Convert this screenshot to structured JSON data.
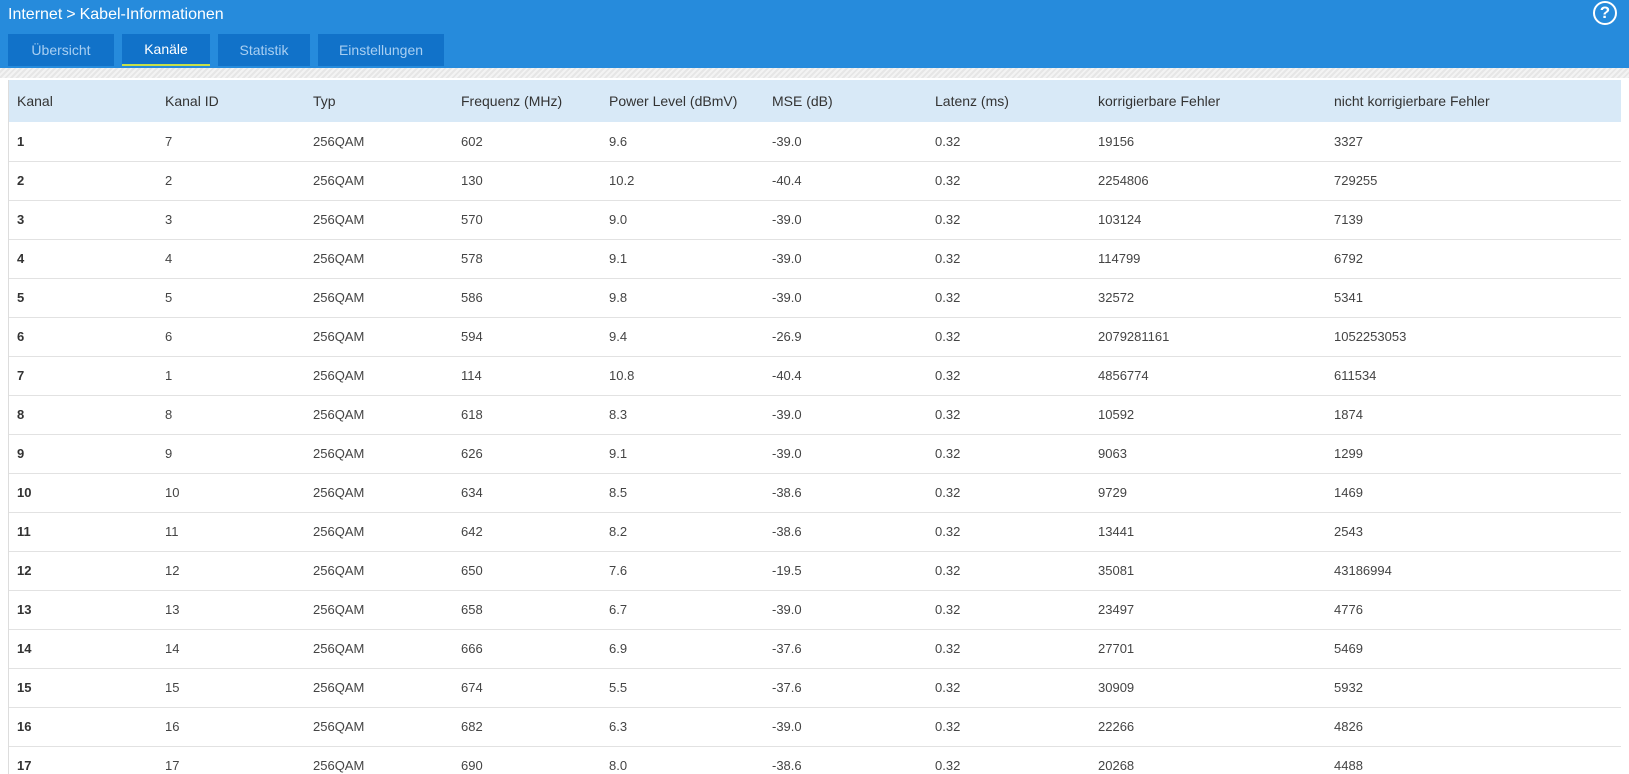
{
  "breadcrumb": {
    "parent": "Internet",
    "separator": ">",
    "current": "Kabel-Informationen"
  },
  "help_label": "?",
  "tabs": [
    {
      "label": "Übersicht",
      "active": false
    },
    {
      "label": "Kanäle",
      "active": true
    },
    {
      "label": "Statistik",
      "active": false
    },
    {
      "label": "Einstellungen",
      "active": false
    }
  ],
  "colors": {
    "header": "#268bdc",
    "tab": "#1172c9",
    "active_underline": "#c6e04a",
    "table_header": "#d8e9f7"
  },
  "table": {
    "columns": [
      "Kanal",
      "Kanal ID",
      "Typ",
      "Frequenz (MHz)",
      "Power Level (dBmV)",
      "MSE (dB)",
      "Latenz (ms)",
      "korrigierbare Fehler",
      "nicht korrigierbare Fehler"
    ],
    "rows": [
      [
        "1",
        "7",
        "256QAM",
        "602",
        "9.6",
        "-39.0",
        "0.32",
        "19156",
        "3327"
      ],
      [
        "2",
        "2",
        "256QAM",
        "130",
        "10.2",
        "-40.4",
        "0.32",
        "2254806",
        "729255"
      ],
      [
        "3",
        "3",
        "256QAM",
        "570",
        "9.0",
        "-39.0",
        "0.32",
        "103124",
        "7139"
      ],
      [
        "4",
        "4",
        "256QAM",
        "578",
        "9.1",
        "-39.0",
        "0.32",
        "114799",
        "6792"
      ],
      [
        "5",
        "5",
        "256QAM",
        "586",
        "9.8",
        "-39.0",
        "0.32",
        "32572",
        "5341"
      ],
      [
        "6",
        "6",
        "256QAM",
        "594",
        "9.4",
        "-26.9",
        "0.32",
        "2079281161",
        "1052253053"
      ],
      [
        "7",
        "1",
        "256QAM",
        "114",
        "10.8",
        "-40.4",
        "0.32",
        "4856774",
        "611534"
      ],
      [
        "8",
        "8",
        "256QAM",
        "618",
        "8.3",
        "-39.0",
        "0.32",
        "10592",
        "1874"
      ],
      [
        "9",
        "9",
        "256QAM",
        "626",
        "9.1",
        "-39.0",
        "0.32",
        "9063",
        "1299"
      ],
      [
        "10",
        "10",
        "256QAM",
        "634",
        "8.5",
        "-38.6",
        "0.32",
        "9729",
        "1469"
      ],
      [
        "11",
        "11",
        "256QAM",
        "642",
        "8.2",
        "-38.6",
        "0.32",
        "13441",
        "2543"
      ],
      [
        "12",
        "12",
        "256QAM",
        "650",
        "7.6",
        "-19.5",
        "0.32",
        "35081",
        "43186994"
      ],
      [
        "13",
        "13",
        "256QAM",
        "658",
        "6.7",
        "-39.0",
        "0.32",
        "23497",
        "4776"
      ],
      [
        "14",
        "14",
        "256QAM",
        "666",
        "6.9",
        "-37.6",
        "0.32",
        "27701",
        "5469"
      ],
      [
        "15",
        "15",
        "256QAM",
        "674",
        "5.5",
        "-37.6",
        "0.32",
        "30909",
        "5932"
      ],
      [
        "16",
        "16",
        "256QAM",
        "682",
        "6.3",
        "-39.0",
        "0.32",
        "22266",
        "4826"
      ],
      [
        "17",
        "17",
        "256QAM",
        "690",
        "8.0",
        "-38.6",
        "0.32",
        "20268",
        "4488"
      ]
    ]
  }
}
